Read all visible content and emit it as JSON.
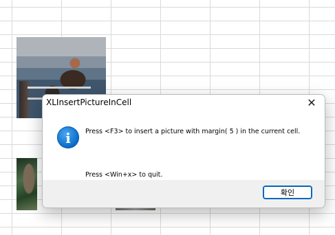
{
  "dialog": {
    "title": "XLInsertPictureInCell",
    "close_glyph": "✕",
    "icon": "information-icon",
    "icon_letter": "i",
    "message_line1": "Press <F3> to insert a picture  with margin( 5 ) in the current cell.",
    "message_line2": "Press <Win+x> to quit.",
    "ok_label": "확인"
  },
  "colors": {
    "accent": "#0067c0",
    "footer_bg": "#f0f0f0",
    "gridline": "#d9d9d9"
  }
}
